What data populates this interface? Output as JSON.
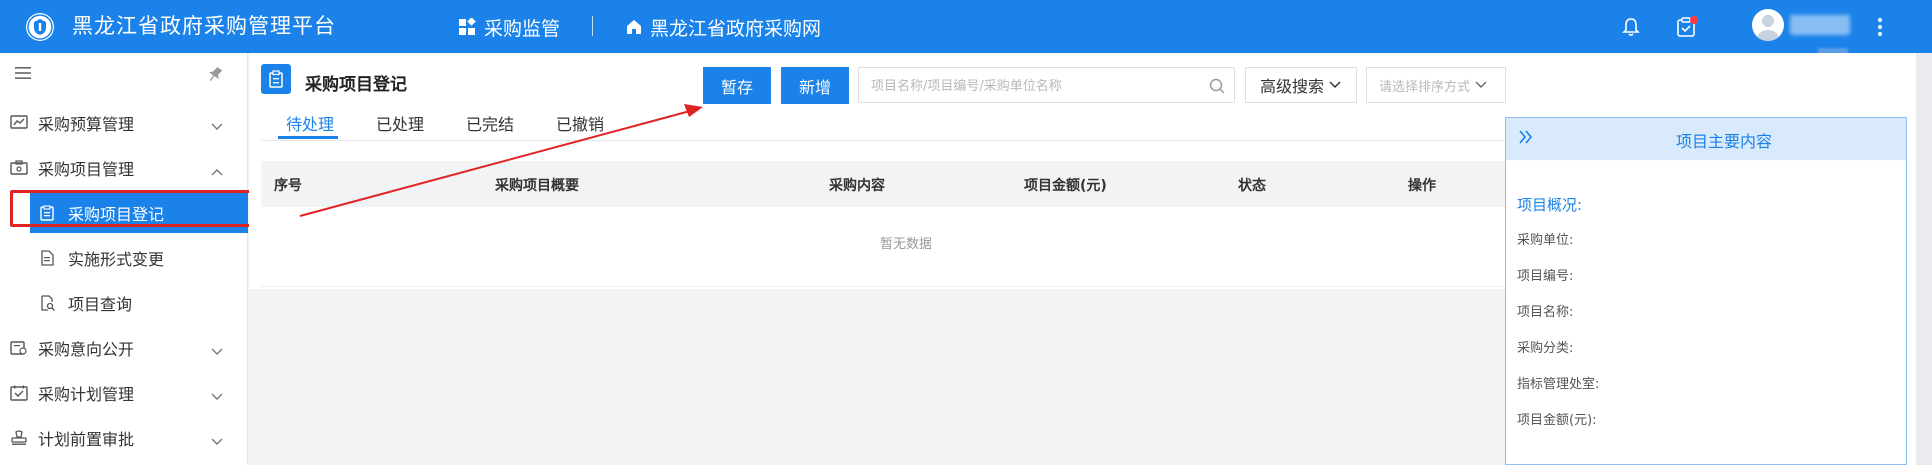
{
  "header": {
    "app_title": "黑龙江省政府采购管理平台",
    "nav": [
      {
        "label": "采购监管",
        "icon": "grid-icon"
      },
      {
        "label": "黑龙江省政府采购网",
        "icon": "home-icon"
      }
    ],
    "icons": [
      "bell-icon",
      "task-icon",
      "avatar",
      "more-vertical-icon"
    ],
    "accent_color": "#1a82e8",
    "notification_dot_color": "#ff3b3b"
  },
  "sidebar": {
    "items": [
      {
        "label": "采购预算管理",
        "icon": "budget-icon",
        "expanded": false
      },
      {
        "label": "采购项目管理",
        "icon": "project-icon",
        "expanded": true,
        "children": [
          {
            "label": "采购项目登记",
            "icon": "register-icon",
            "active": true
          },
          {
            "label": "实施形式变更",
            "icon": "change-icon",
            "active": false
          },
          {
            "label": "项目查询",
            "icon": "query-icon",
            "active": false
          }
        ]
      },
      {
        "label": "采购意向公开",
        "icon": "intent-icon",
        "expanded": false
      },
      {
        "label": "采购计划管理",
        "icon": "plan-icon",
        "expanded": false
      },
      {
        "label": "计划前置审批",
        "icon": "approval-icon",
        "expanded": false
      }
    ]
  },
  "main": {
    "page_title": "采购项目登记",
    "tabs": [
      {
        "label": "待处理",
        "active": true
      },
      {
        "label": "已处理",
        "active": false
      },
      {
        "label": "已完结",
        "active": false
      },
      {
        "label": "已撤销",
        "active": false
      }
    ],
    "toolbar": {
      "save_label": "暂存",
      "add_label": "新增",
      "search_placeholder": "项目名称/项目编号/采购单位名称",
      "advanced_search_label": "高级搜索",
      "sort_placeholder": "请选择排序方式"
    },
    "table": {
      "columns": [
        "序号",
        "采购项目概要",
        "采购内容",
        "项目金额(元)",
        "状态",
        "操作"
      ],
      "rows": [],
      "empty_text": "暂无数据"
    }
  },
  "panel": {
    "title": "项目主要内容",
    "section_title": "项目概况:",
    "fields": [
      "采购单位:",
      "项目编号:",
      "项目名称:",
      "采购分类:",
      "指标管理处室:",
      "项目金额(元):"
    ]
  },
  "annotation": {
    "highlight_color": "#e02424"
  }
}
